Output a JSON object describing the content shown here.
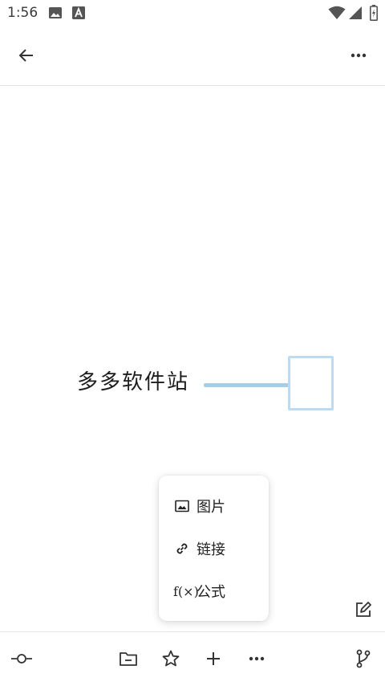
{
  "status_bar": {
    "time": "1:56",
    "icons": [
      "image-icon",
      "accessibility-a-icon",
      "wifi-icon",
      "signal-icon",
      "battery-charging-icon"
    ]
  },
  "app_bar": {
    "back_icon": "arrow-left-icon",
    "more_icon": "more-horizontal-icon"
  },
  "canvas": {
    "node_text": "多多软件站",
    "colors": {
      "connector": "#a8cde9",
      "box_border": "#bcdaf2"
    }
  },
  "insert_menu": {
    "items": [
      {
        "icon": "image-icon",
        "label": "图片"
      },
      {
        "icon": "link-icon",
        "label": "链接"
      },
      {
        "icon": "formula-icon",
        "icon_text": "f(×)",
        "label": "公式"
      }
    ]
  },
  "floating": {
    "edit_icon": "edit-icon"
  },
  "toolbar": {
    "icons": [
      "commit-node-icon",
      "folder-minus-icon",
      "star-icon",
      "plus-icon",
      "more-horizontal-icon",
      "branch-icon"
    ]
  }
}
